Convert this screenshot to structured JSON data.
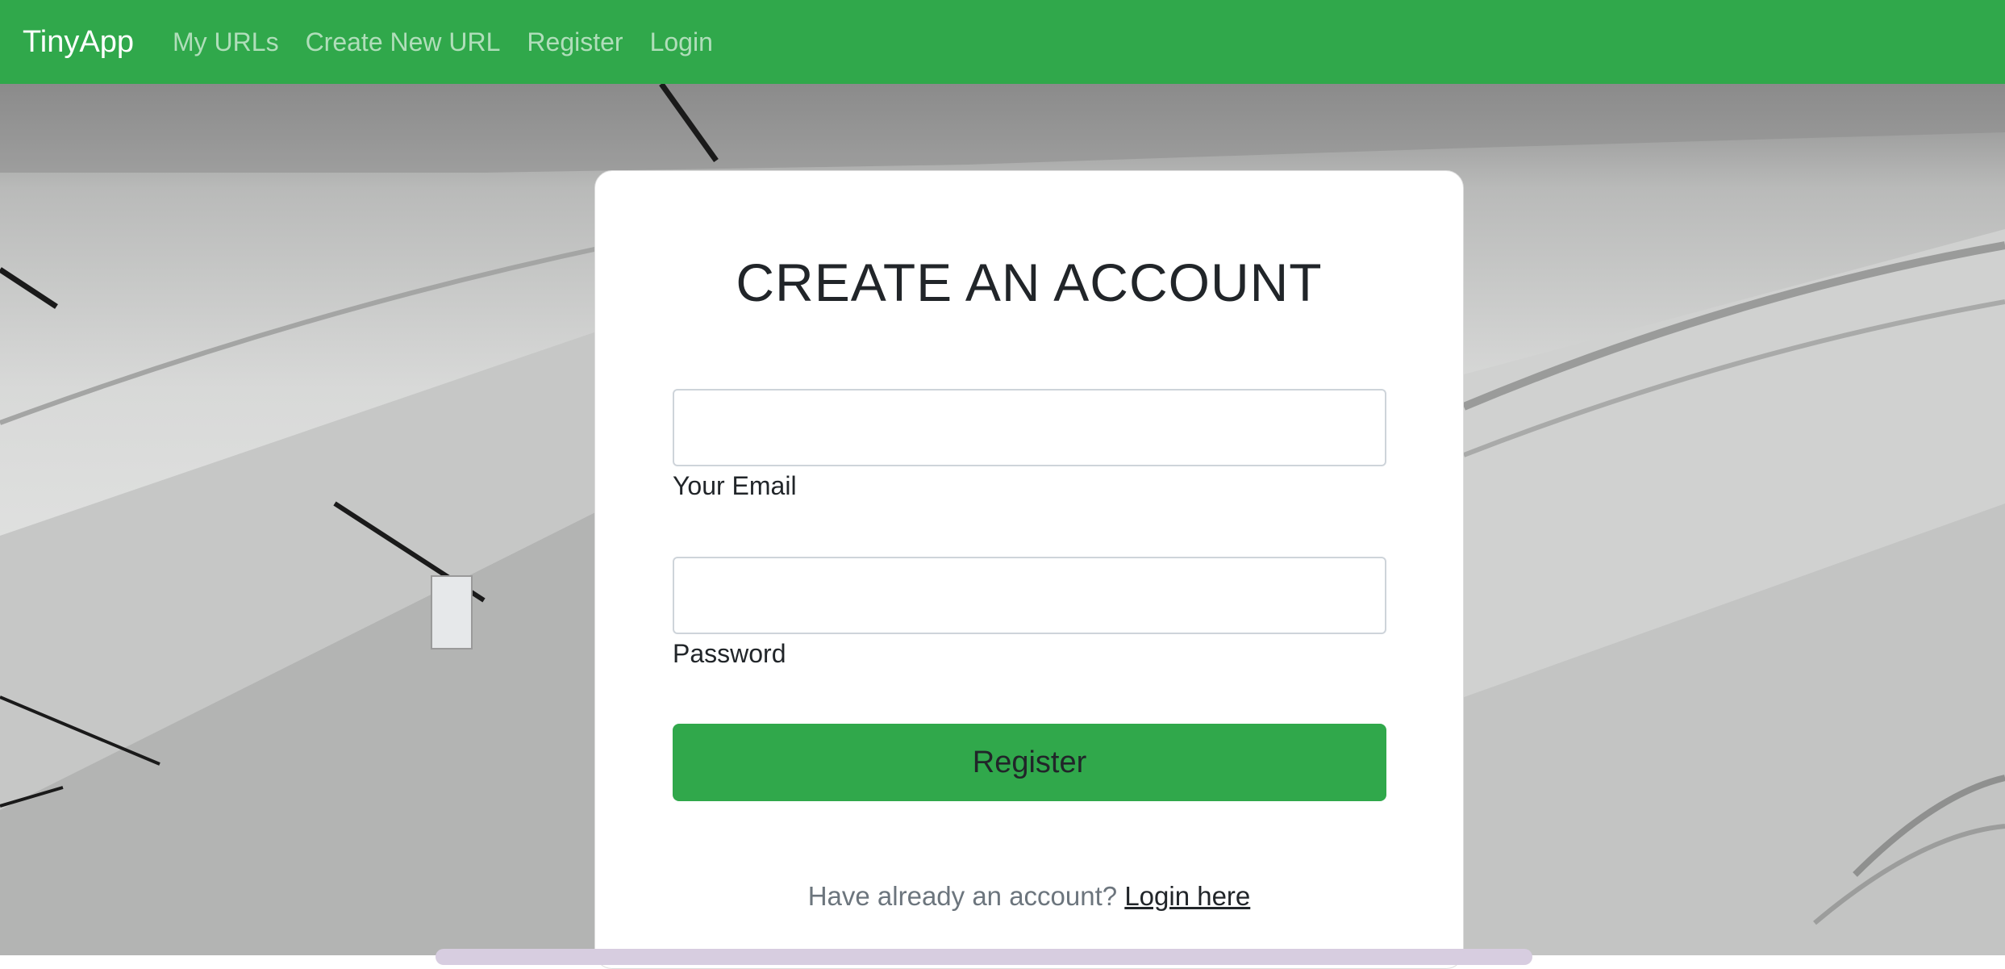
{
  "navbar": {
    "brand": "TinyApp",
    "links": [
      "My URLs",
      "Create New URL",
      "Register",
      "Login"
    ],
    "color": "#30a84b"
  },
  "form": {
    "title": "CREATE AN ACCOUNT",
    "email_label": "Your Email",
    "email_value": "",
    "password_label": "Password",
    "password_value": "",
    "submit_label": "Register",
    "footer_prompt": "Have already an account?",
    "footer_link": "Login here"
  }
}
